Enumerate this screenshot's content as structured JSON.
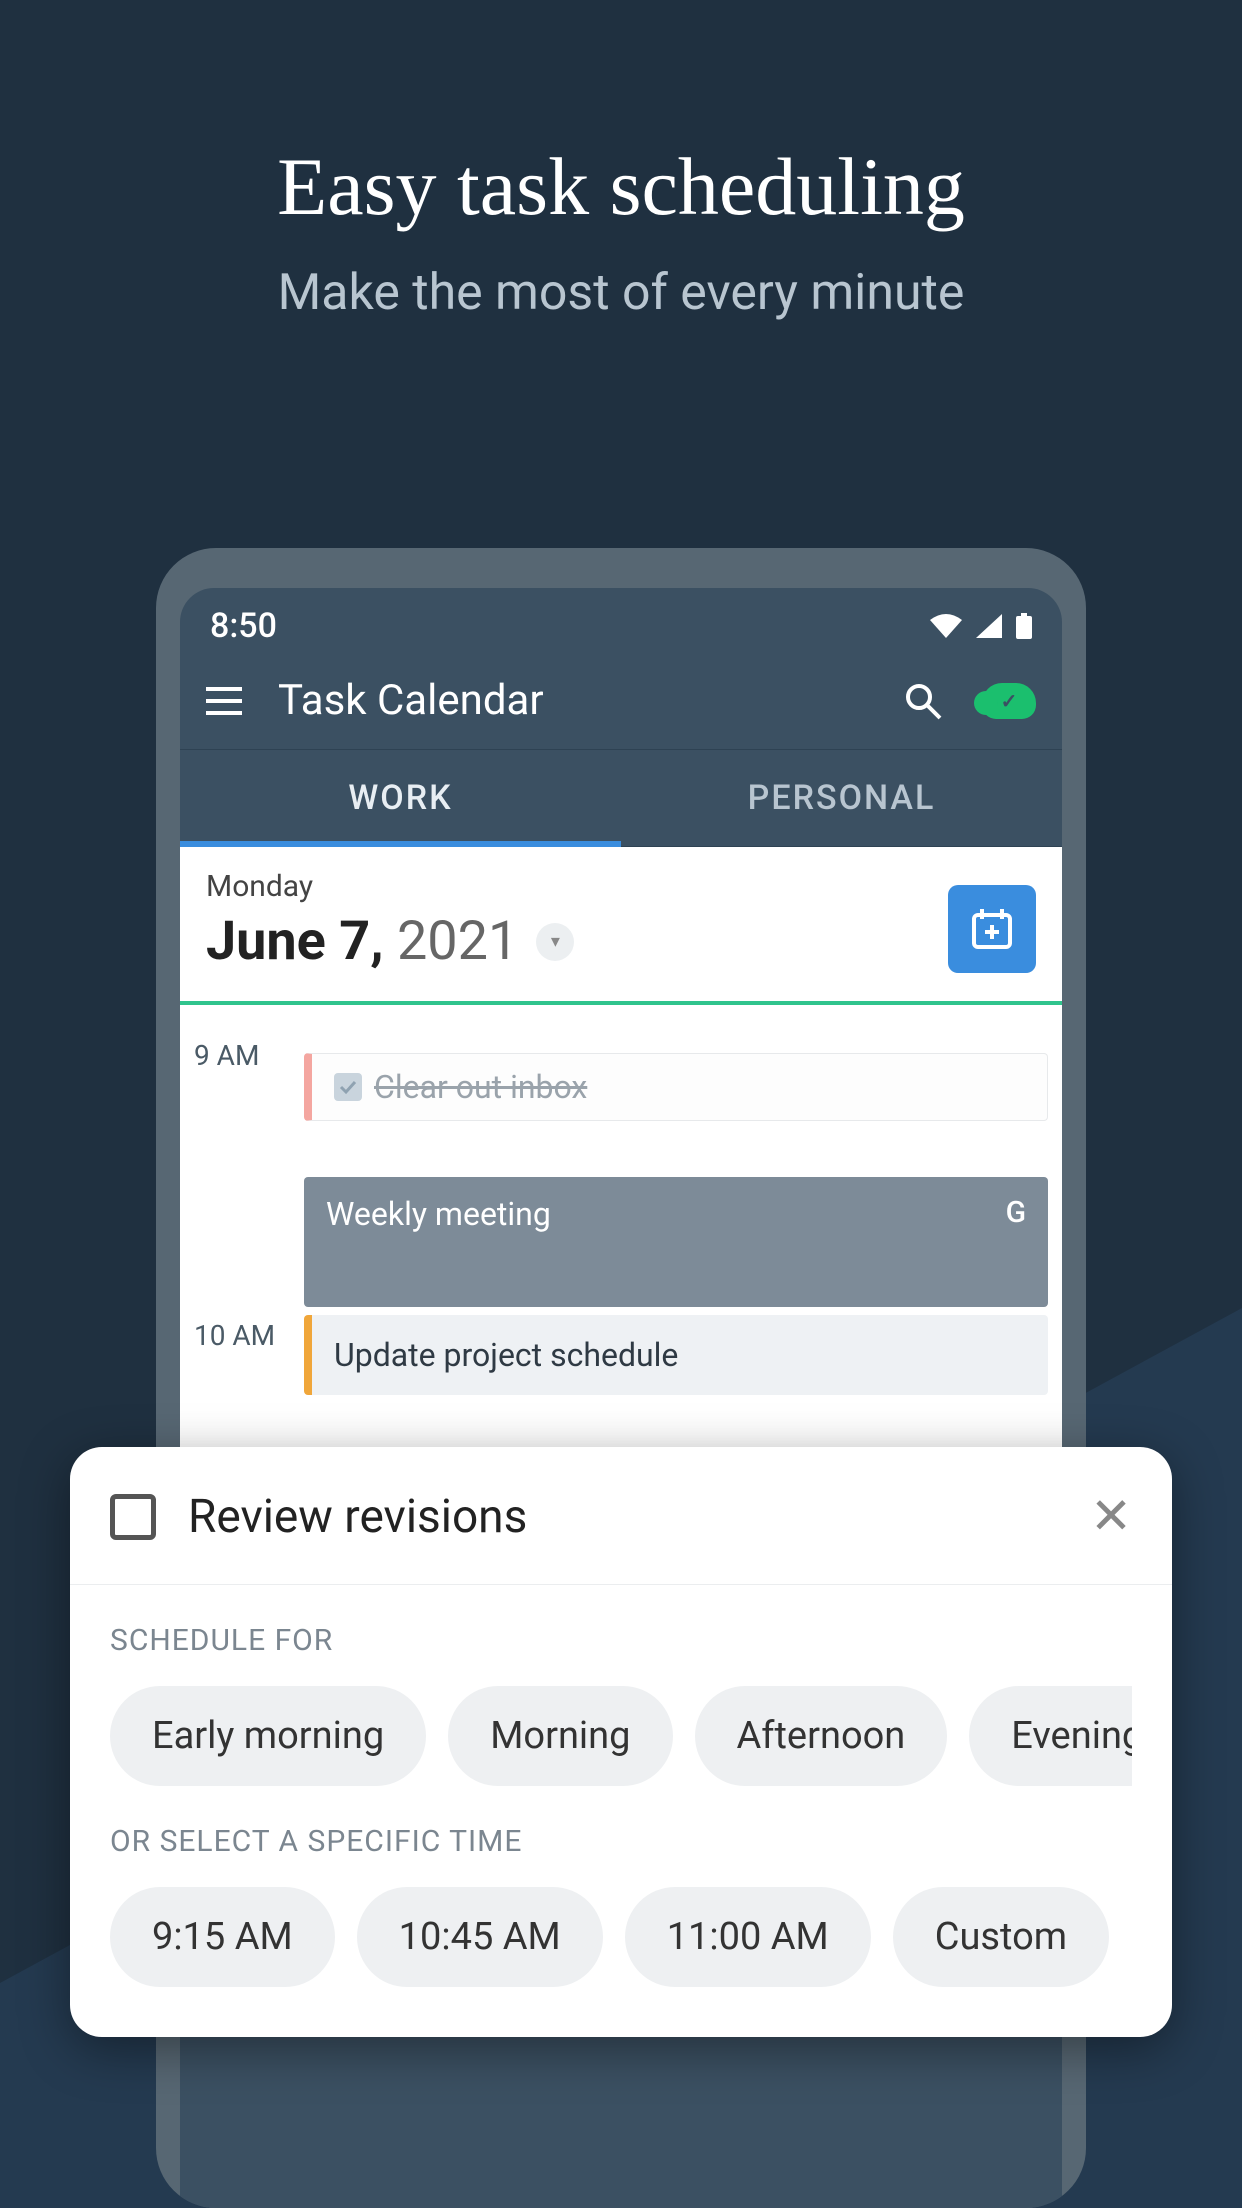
{
  "promo": {
    "title": "Easy task scheduling",
    "subtitle": "Make the most of every minute"
  },
  "status": {
    "time": "8:50"
  },
  "appbar": {
    "title": "Task Calendar"
  },
  "tabs": [
    {
      "label": "WORK",
      "active": true
    },
    {
      "label": "PERSONAL",
      "active": false
    }
  ],
  "date": {
    "day_name": "Monday",
    "month_day": "June 7,",
    "year": "2021"
  },
  "timeline": {
    "labels": {
      "nine": "9 AM",
      "ten": "10 AM"
    },
    "events": {
      "done": "Clear out inbox",
      "meeting": "Weekly meeting",
      "meeting_source": "G",
      "update": "Update project schedule"
    }
  },
  "sheet": {
    "task_title": "Review revisions",
    "schedule_label": "SCHEDULE FOR",
    "schedule_chips": [
      "Early morning",
      "Morning",
      "Afternoon",
      "Evening"
    ],
    "time_label": "OR SELECT A SPECIFIC TIME",
    "time_chips": [
      "9:15 AM",
      "10:45 AM",
      "11:00 AM",
      "Custom"
    ]
  }
}
